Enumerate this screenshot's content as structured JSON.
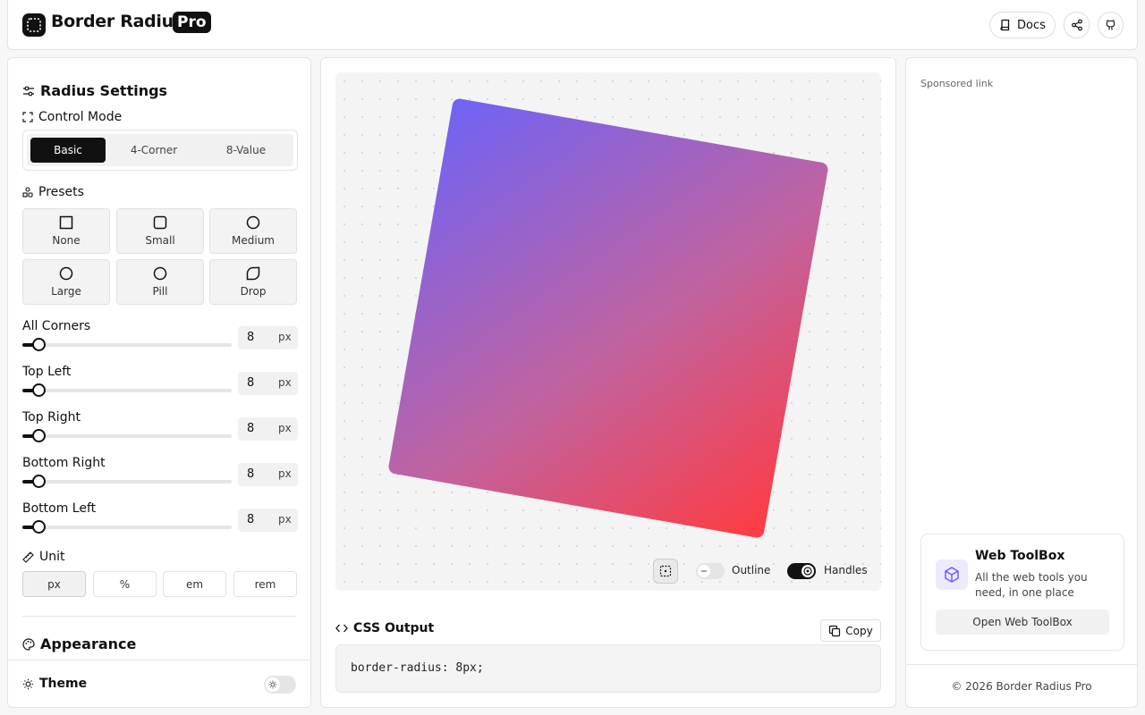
{
  "header": {
    "title": "Border Radius",
    "badge": "Pro",
    "docs_label": "Docs"
  },
  "settings": {
    "title": "Radius Settings",
    "control_mode_label": "Control Mode",
    "modes": [
      "Basic",
      "4-Corner",
      "8-Value"
    ],
    "active_mode": "Basic",
    "presets_label": "Presets",
    "presets": [
      "None",
      "Small",
      "Medium",
      "Large",
      "Pill",
      "Drop"
    ],
    "sliders": [
      {
        "label": "All Corners",
        "value": "8",
        "unit": "px"
      },
      {
        "label": "Top Left",
        "value": "8",
        "unit": "px"
      },
      {
        "label": "Top Right",
        "value": "8",
        "unit": "px"
      },
      {
        "label": "Bottom Right",
        "value": "8",
        "unit": "px"
      },
      {
        "label": "Bottom Left",
        "value": "8",
        "unit": "px"
      }
    ],
    "slider_fraction": 0.08,
    "unit_label": "Unit",
    "units": [
      "px",
      "%",
      "em",
      "rem"
    ],
    "active_unit": "px",
    "appearance_label": "Appearance",
    "theme_label": "Theme"
  },
  "preview": {
    "outline_label": "Outline",
    "outline_on": false,
    "handles_label": "Handles",
    "handles_on": true,
    "gradient_colors": [
      "#6f63f5",
      "#c063a0",
      "#ff3b42"
    ]
  },
  "css_output": {
    "title": "CSS Output",
    "copy_label": "Copy",
    "code": "border-radius: 8px;"
  },
  "sidebar": {
    "sponsored": "Sponsored link",
    "ad_title": "Web ToolBox",
    "ad_desc": "All the web tools you need, in one place",
    "ad_button": "Open Web ToolBox",
    "footer": "© 2026 Border Radius Pro"
  }
}
